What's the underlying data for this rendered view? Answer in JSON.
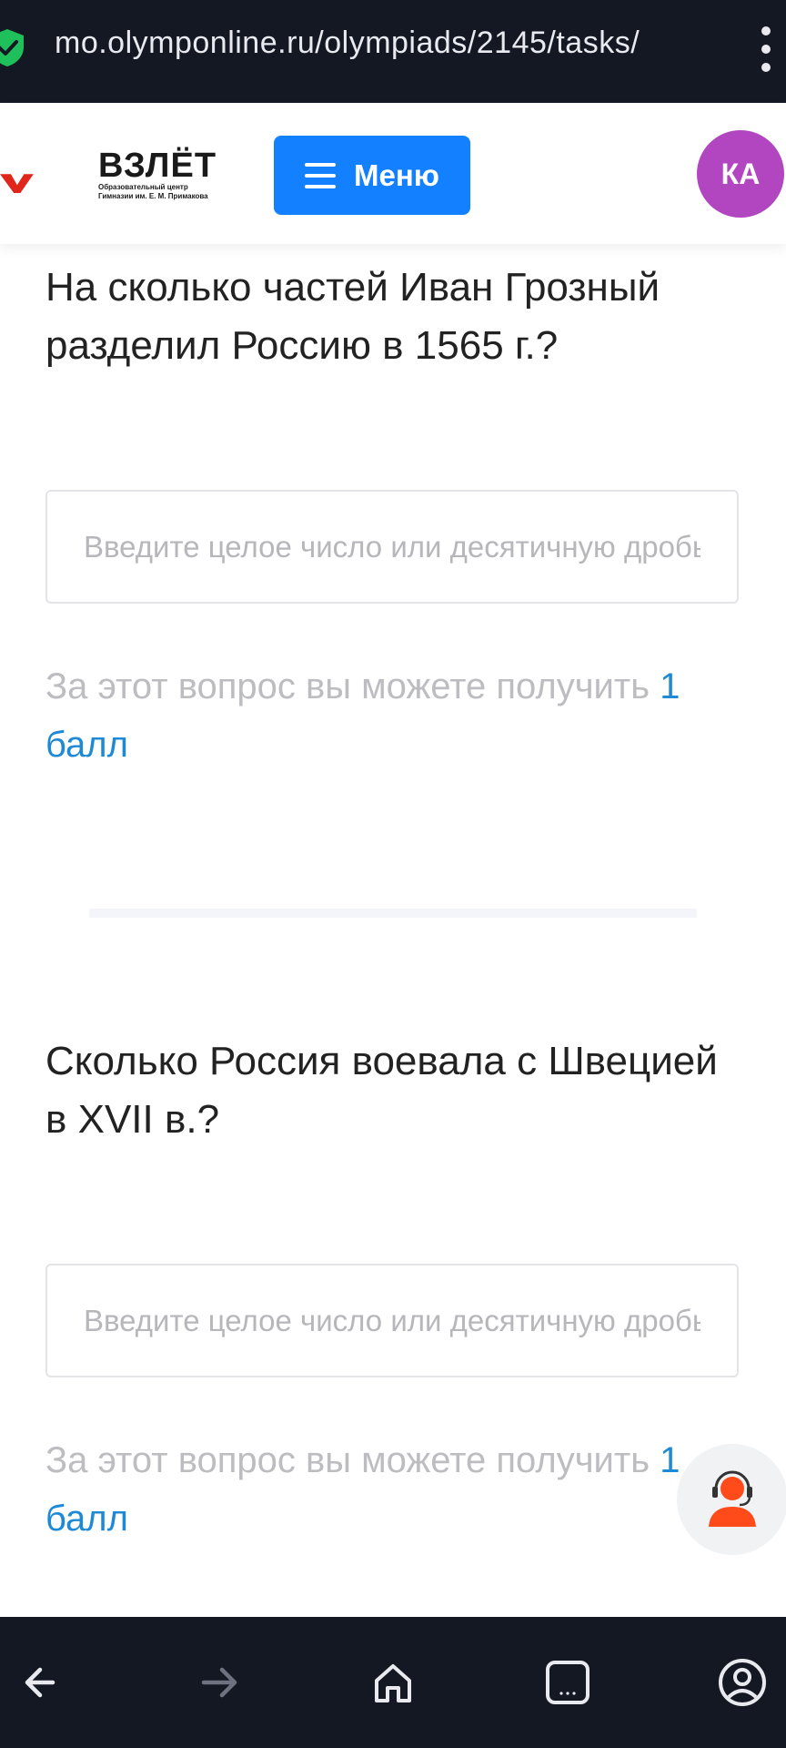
{
  "browser": {
    "url": "mo.olymponline.ru/olympiads/2145/tasks/"
  },
  "header": {
    "logo_title": "ВЗЛЁТ",
    "logo_subtitle_line1": "Образовательный центр",
    "logo_subtitle_line2": "Гимназии им. Е. М. Примакова",
    "menu_label": "Меню",
    "avatar_initials": "КА"
  },
  "questions": [
    {
      "title": "На сколько частей Иван Грозный разделил Россию в 1565 г.?",
      "placeholder": "Введите целое число или десятичную дробь",
      "points_prefix": "За этот вопрос вы можете получить",
      "points_value": "1 балл"
    },
    {
      "title": "Сколько Россия воевала с Швецией в XVII в.?",
      "placeholder": "Введите целое число или десятичную дробь",
      "points_prefix": "За этот вопрос вы можете получить",
      "points_value": "1 балл"
    }
  ],
  "colors": {
    "accent": "#1380ff",
    "avatar": "#b245c0",
    "logo_red": "#e0251b",
    "points_value": "#1e8ad6",
    "support_orange": "#ff4a1a"
  },
  "icons": {
    "secure": "shield-check-icon",
    "menu": "hamburger-icon",
    "support": "support-agent-icon",
    "back": "arrow-left-icon",
    "forward": "arrow-right-icon",
    "home": "home-icon",
    "tabs": "tabs-icon",
    "account": "account-icon"
  }
}
